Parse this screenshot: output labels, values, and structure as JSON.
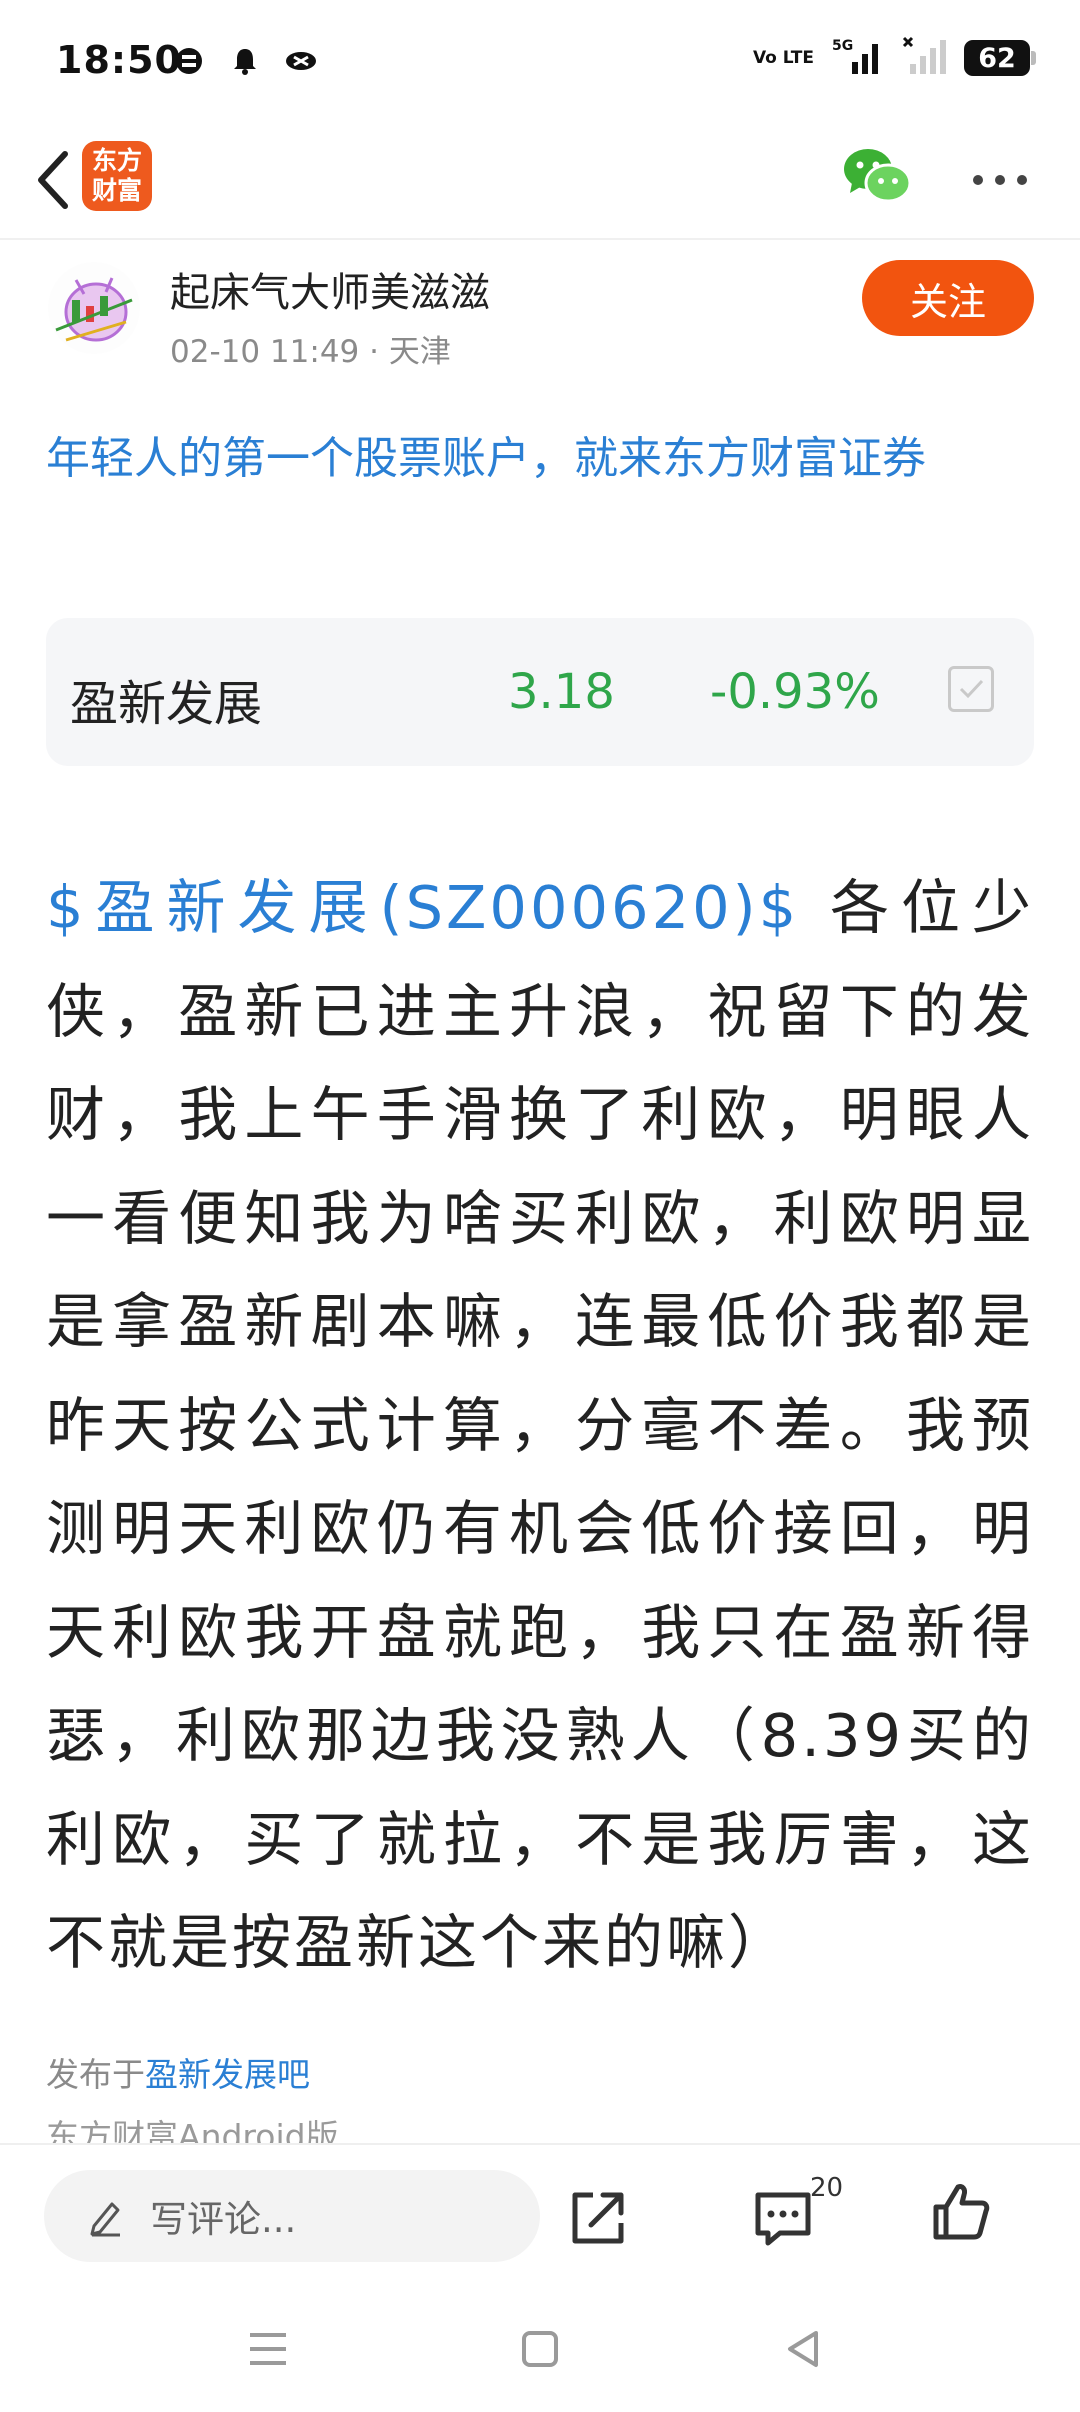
{
  "status_bar": {
    "time": "18:50",
    "volte": "Vo LTE",
    "network": "5G",
    "battery": "62",
    "icons": [
      "sim-icon",
      "notification-bell-icon",
      "link-icon",
      "wifi-signal-icon",
      "signal-x-icon"
    ]
  },
  "nav": {
    "app_logo_text": "东方财富",
    "icons": [
      "back-arrow-icon",
      "wechat-icon",
      "more-icon"
    ]
  },
  "author": {
    "name": "起床气大师美滋滋",
    "meta": "02-10 11:49 · 天津",
    "follow_label": "关注"
  },
  "ad": {
    "text": "年轻人的第一个股票账户，就来东方财富证券"
  },
  "stock": {
    "name": "盈新发展",
    "price": "3.18",
    "change": "-0.93%",
    "color": "#2fa64a"
  },
  "post": {
    "stock_tag": "$盈新发展(SZ000620)$",
    "content": "  各位少侠，盈新已进主升浪，祝留下的发财，我上午手滑换了利欧，明眼人一看便知我为啥买利欧，利欧明显是拿盈新剧本嘛，连最低价我都是昨天按公式计算，分毫不差。我预测明天利欧仍有机会低价接回，明天利欧我开盘就跑，我只在盈新得瑟，利欧那边我没熟人（8.39买的利欧，买了就拉，不是我厉害，这不就是按盈新这个来的嘛）"
  },
  "footer": {
    "published_prefix": "发布于",
    "published_link": "盈新发展吧",
    "platform": "东方财富Android版"
  },
  "bottom_bar": {
    "comment_placeholder": "写评论...",
    "comments_count": "20",
    "icons": [
      "pencil-icon",
      "share-icon",
      "comment-icon",
      "like-icon"
    ]
  },
  "colors": {
    "accent": "#f2540f",
    "link": "#2a7fd4",
    "down": "#2fa64a"
  }
}
